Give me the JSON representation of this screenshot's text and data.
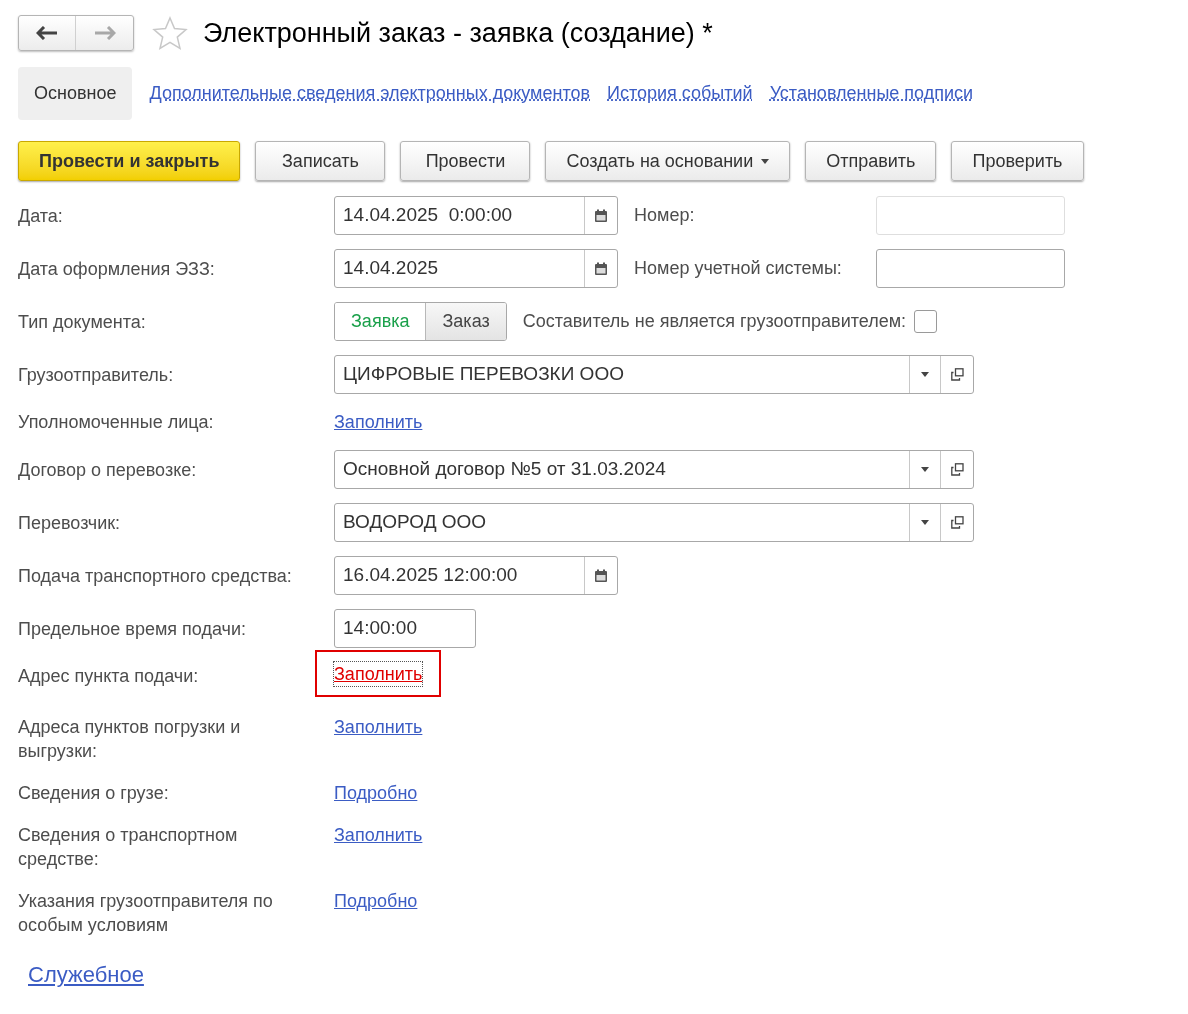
{
  "window": {
    "title": "Электронный заказ - заявка (создание) *"
  },
  "tabs": [
    {
      "label": "Основное",
      "selected": true
    },
    {
      "label": "Дополнительные сведения электронных документов",
      "selected": false
    },
    {
      "label": "История событий",
      "selected": false
    },
    {
      "label": "Установленные подписи",
      "selected": false
    }
  ],
  "toolbar": [
    {
      "label": "Провести и закрыть",
      "kind": "primary"
    },
    {
      "label": "Записать",
      "kind": "plain"
    },
    {
      "label": "Провести",
      "kind": "plain"
    },
    {
      "label": "Создать на основании",
      "kind": "menu"
    },
    {
      "label": "Отправить",
      "kind": "plain"
    },
    {
      "label": "Проверить",
      "kind": "plain"
    }
  ],
  "fields": [
    {
      "kind": "date",
      "label": "Дата:",
      "value": "14.04.2025  0:00:00",
      "side": {
        "label": "Номер:",
        "disabled": true
      }
    },
    {
      "kind": "date",
      "label": "Дата оформления ЭЗЗ:",
      "value": "14.04.2025",
      "side": {
        "label": "Номер учетной системы:",
        "disabled": false
      }
    },
    {
      "kind": "switch",
      "label": "Тип документа:",
      "options": [
        {
          "label": "Заявка",
          "selected": true
        },
        {
          "label": "Заказ",
          "selected": false
        }
      ],
      "checkbox": {
        "label": "Составитель не является грузоотправителем:",
        "checked": false
      }
    },
    {
      "kind": "select",
      "label": "Грузоотправитель:",
      "value": "ЦИФРОВЫЕ ПЕРЕВОЗКИ ООО"
    },
    {
      "kind": "link",
      "label": "Уполномоченные лица:",
      "link": "Заполнить",
      "highlighted": false
    },
    {
      "kind": "select",
      "label": "Договор о перевозке:",
      "value": "Основной договор №5 от 31.03.2024"
    },
    {
      "kind": "select",
      "label": "Перевозчик:",
      "value": "ВОДОРОД ООО"
    },
    {
      "kind": "date",
      "label": "Подача транспортного средства:",
      "value": "16.04.2025 12:00:00"
    },
    {
      "kind": "time",
      "label": "Предельное время подачи:",
      "value": "14:00:00"
    },
    {
      "kind": "link",
      "label": "Адрес пункта подачи:",
      "link": "Заполнить",
      "highlighted": true
    },
    {
      "kind": "link",
      "label": "Адреса пунктов погрузки и выгрузки:",
      "link": "Заполнить",
      "highlighted": false
    },
    {
      "kind": "link",
      "label": "Сведения о грузе:",
      "link": "Подробно",
      "highlighted": false
    },
    {
      "kind": "link",
      "label": "Сведения о транспортном средстве:",
      "link": "Заполнить",
      "highlighted": false
    },
    {
      "kind": "link",
      "label": "Указания грузоотправителя по особым условиям",
      "link": "Подробно",
      "highlighted": false
    }
  ],
  "footer_link": "Служебное"
}
